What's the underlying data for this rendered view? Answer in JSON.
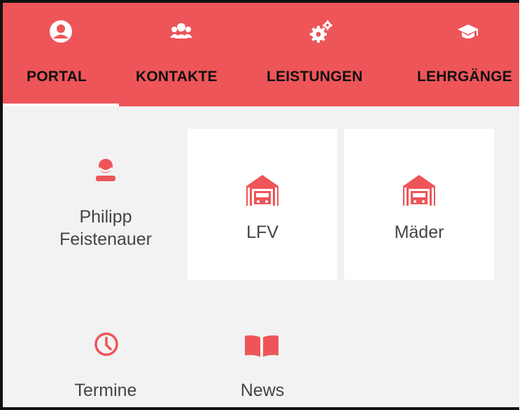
{
  "colors": {
    "accent": "#ee5558",
    "tab_text": "#111111",
    "label_text": "#444444",
    "background": "#f2f2f2",
    "card": "#ffffff"
  },
  "tabs": [
    {
      "label": "PORTAL",
      "icon": "user-circle-icon",
      "active": true
    },
    {
      "label": "KONTAKTE",
      "icon": "contacts-group-icon",
      "active": false
    },
    {
      "label": "LEISTUNGEN",
      "icon": "gears-icon",
      "active": false
    },
    {
      "label": "LEHRGÄNGE",
      "icon": "graduation-cap-icon",
      "active": false
    }
  ],
  "tiles": [
    {
      "label_line1": "Philipp",
      "label_line2": "Feistenauer",
      "icon": "user-icon"
    },
    {
      "label": "LFV",
      "icon": "fire-station-icon"
    },
    {
      "label": "Mäder",
      "icon": "fire-station-icon"
    },
    {
      "label": "Termine",
      "icon": "clock-icon"
    },
    {
      "label": "News",
      "icon": "book-icon"
    }
  ]
}
